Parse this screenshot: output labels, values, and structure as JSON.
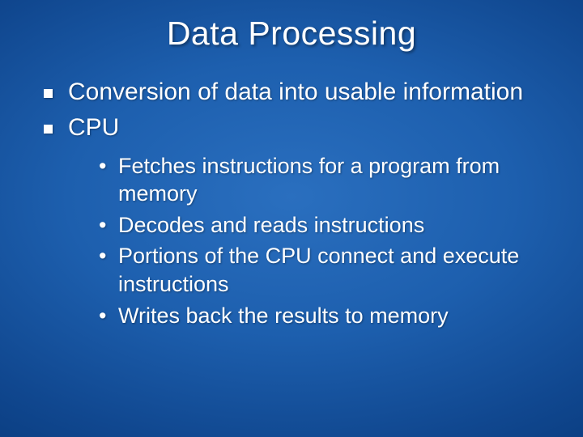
{
  "slide": {
    "title": "Data Processing",
    "bullets": [
      {
        "text": "Conversion of data into usable information"
      },
      {
        "text": "CPU"
      }
    ],
    "subbullets": [
      {
        "marker": "•",
        "text": "Fetches instructions for a program from memory"
      },
      {
        "marker": "•",
        "text": "Decodes and reads instructions"
      },
      {
        "marker": "•",
        "text": "Portions of the CPU connect and execute instructions"
      },
      {
        "marker": "•",
        "text": "Writes back the results to memory"
      }
    ]
  }
}
